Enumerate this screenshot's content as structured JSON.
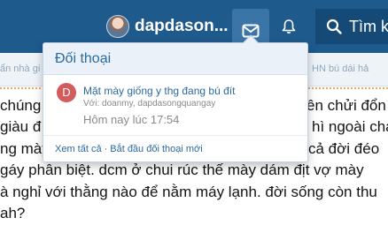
{
  "nav": {
    "username": "dapdason...",
    "search_label": "Tìm k"
  },
  "subnav": {
    "left_text": "ẩn nhà gi",
    "right_text": "HN bú dái hả"
  },
  "post_lines": [
    "chúng",
    "giàu đ",
    "ng mày",
    "gáy phân biệt. dcm ở chui rúc thế mày dám địt vợ mày",
    "à nghỉ với thằng nào để nằm máy lạnh. đời sống còn thu",
    "ah?"
  ],
  "post_right_fragments": [
    "ên chửi đổn",
    "hì ngoài cha",
    "cả đời đéo"
  ],
  "conversations": {
    "title": "Đối thoại",
    "items": [
      {
        "avatar_letter": "D",
        "title": "Mặt mày giống y thg đang bú đít",
        "participants": "Với: doanmy, dapdasongquangay",
        "time": "Hôm nay lúc 17:54"
      }
    ],
    "footer": {
      "view_all": "Xem tất cả",
      "separator": "·",
      "start_new": "Bắt đầu đối thoại mới"
    }
  },
  "colors": {
    "topbar": "#1f5a8c",
    "link": "#2b6aa0",
    "avatar_bg": "#d35b5b"
  },
  "icons": [
    "envelope-icon",
    "bell-icon",
    "search-icon"
  ]
}
